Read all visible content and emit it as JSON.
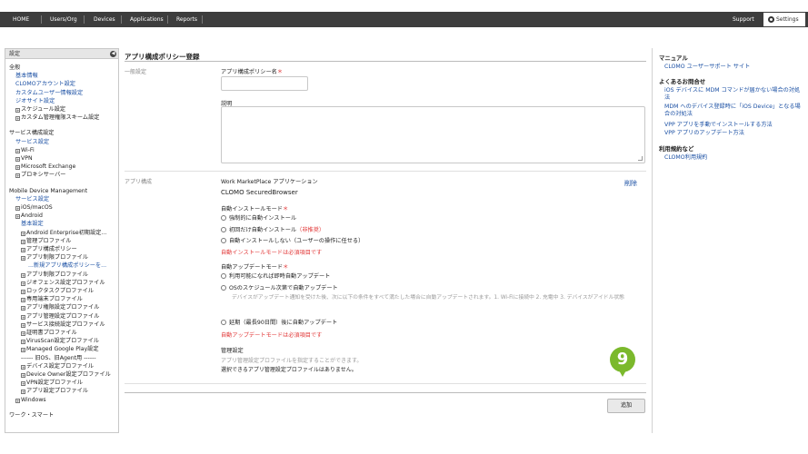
{
  "nav": {
    "items": [
      "HOME",
      "Users/Org",
      "Devices",
      "Applications",
      "Reports"
    ],
    "support": "Support",
    "settings": "Settings"
  },
  "sidebar": {
    "header": "設定",
    "lines": [
      {
        "text": "全般",
        "kind": "plain",
        "indent": 0
      },
      {
        "text": "基本情報",
        "kind": "link",
        "indent": 1
      },
      {
        "text": "CLOMOアカウント設定",
        "kind": "link",
        "indent": 1
      },
      {
        "text": "カスタムユーザー情報設定",
        "kind": "link",
        "indent": 1
      },
      {
        "text": "ジオサイト設定",
        "kind": "link",
        "indent": 1
      },
      {
        "text": "スケジュール設定",
        "kind": "plain",
        "indent": 1,
        "box": true
      },
      {
        "text": "カスタム管理権限スキーム設定",
        "kind": "plain",
        "indent": 1,
        "box": true
      },
      {
        "text": "サービス構成設定",
        "kind": "plain",
        "indent": 0,
        "gap": true
      },
      {
        "text": "サービス設定",
        "kind": "link",
        "indent": 1
      },
      {
        "text": "Wi-Fi",
        "kind": "plain",
        "indent": 1,
        "box": true
      },
      {
        "text": "VPN",
        "kind": "plain",
        "indent": 1,
        "box": true
      },
      {
        "text": "Microsoft Exchange",
        "kind": "plain",
        "indent": 1,
        "box": true
      },
      {
        "text": "プロキシサーバー",
        "kind": "plain",
        "indent": 1,
        "box": true
      },
      {
        "text": "Mobile Device Management",
        "kind": "plain",
        "indent": 0,
        "gap": true
      },
      {
        "text": "サービス設定",
        "kind": "link",
        "indent": 1
      },
      {
        "text": "iOS/macOS",
        "kind": "plain",
        "indent": 1,
        "box": true
      },
      {
        "text": "Android",
        "kind": "plain",
        "indent": 1,
        "box": true
      },
      {
        "text": "基本設定",
        "kind": "link",
        "indent": 2
      },
      {
        "text": "Android Enterprise初期設定...",
        "kind": "plain",
        "indent": 2,
        "box": true
      },
      {
        "text": "管理プロファイル",
        "kind": "plain",
        "indent": 2,
        "box": true
      },
      {
        "text": "アプリ構成ポリシー",
        "kind": "plain",
        "indent": 2,
        "box": true
      },
      {
        "text": "アプリ制限プロファイル",
        "kind": "plain",
        "indent": 2,
        "box": true
      },
      {
        "text": "...新規アプリ構成ポリシーを...",
        "kind": "link",
        "indent": 3
      },
      {
        "text": "アプリ制限プロファイル",
        "kind": "plain",
        "indent": 2,
        "box": true
      },
      {
        "text": "ジオフェンス設定プロファイル",
        "kind": "plain",
        "indent": 2,
        "box": true
      },
      {
        "text": "ロックタスクプロファイル",
        "kind": "plain",
        "indent": 2,
        "box": true
      },
      {
        "text": "専用端末プロファイル",
        "kind": "plain",
        "indent": 2,
        "box": true
      },
      {
        "text": "アプリ権限設定プロファイル",
        "kind": "plain",
        "indent": 2,
        "box": true
      },
      {
        "text": "アプリ管理設定プロファイル",
        "kind": "plain",
        "indent": 2,
        "box": true
      },
      {
        "text": "サービス接続設定プロファイル",
        "kind": "plain",
        "indent": 2,
        "box": true
      },
      {
        "text": "証明書プロファイル",
        "kind": "plain",
        "indent": 2,
        "box": true
      },
      {
        "text": "VirusScan設定プロファイル",
        "kind": "plain",
        "indent": 2,
        "box": true
      },
      {
        "text": "Managed Google Play設定",
        "kind": "plain",
        "indent": 2,
        "box": true
      },
      {
        "text": "------ 旧OS、旧Agent用 ------",
        "kind": "plain",
        "indent": 2
      },
      {
        "text": "デバイス設定プロファイル",
        "kind": "plain",
        "indent": 2,
        "box": true
      },
      {
        "text": "Device Owner設定プロファイル",
        "kind": "plain",
        "indent": 2,
        "box": true
      },
      {
        "text": "VPN設定プロファイル",
        "kind": "plain",
        "indent": 2,
        "box": true
      },
      {
        "text": "アプリ設定プロファイル",
        "kind": "plain",
        "indent": 2,
        "box": true
      },
      {
        "text": "Windows",
        "kind": "plain",
        "indent": 1,
        "box": true
      },
      {
        "text": "ワーク・スマート",
        "kind": "plain",
        "indent": 0,
        "gap": true
      }
    ]
  },
  "main": {
    "title": "アプリ構成ポリシー登録",
    "general_section": "一般設定",
    "name_label": "アプリ構成ポリシー名",
    "required_mark": "＊",
    "description_label": "説明",
    "app_section": "アプリ構成",
    "app_source": "Work MarketPlace アプリケーション",
    "app_name": "CLOMO SecuredBrowser",
    "delete_label": "削除",
    "install_mode_label": "自動インストールモード",
    "install_options": [
      "強制的に自動インストール",
      "初回だけ自動インストール",
      "自動インストールしない（ユーザーの操作に任せる）"
    ],
    "not_recommended": "（非推奨）",
    "install_error": "自動インストールモードは必須項目です",
    "update_mode_label": "自動アップデートモード",
    "update_options": [
      "利用可能になれば即時自動アップデート",
      "OSのスケジュール次第で自動アップデート",
      "延期（最長90日間）後に自動アップデート"
    ],
    "update_note": "デバイスがアップデート通知を受けた後、次に以下の条件をすべて満たした場合に自動アップデートされます。1. Wi-Fiに接続中 2. 充電中 3. デバイスがアイドル状態",
    "update_error": "自動アップデートモードは必須項目です",
    "mgmt_label": "管理設定",
    "mgmt_hint": "アプリ管理設定プロファイルを指定することができます。",
    "mgmt_none": "選択できるアプリ管理設定プロファイルはありません。",
    "add_button": "追加",
    "step_marker": "9"
  },
  "right": {
    "manual_heading": "マニュアル",
    "manual_link": "CLOMO ユーザーサポート サイト",
    "faq_heading": "よくあるお問合せ",
    "faq_links": [
      "iOS デバイスに MDM コマンドが届かない場合の対処法",
      "MDM へのデバイス登録時に「iOS Device」となる場合の対処法",
      "VPP アプリを手動でインストールする方法",
      "VPP アプリのアップデート方法"
    ],
    "terms_heading": "利用規約など",
    "terms_link": "CLOMO利用規約"
  },
  "colors": {
    "nav": "#3d3d3d",
    "link": "#1a4fa3",
    "required": "#e23a3a",
    "marker": "#7bb92c"
  }
}
